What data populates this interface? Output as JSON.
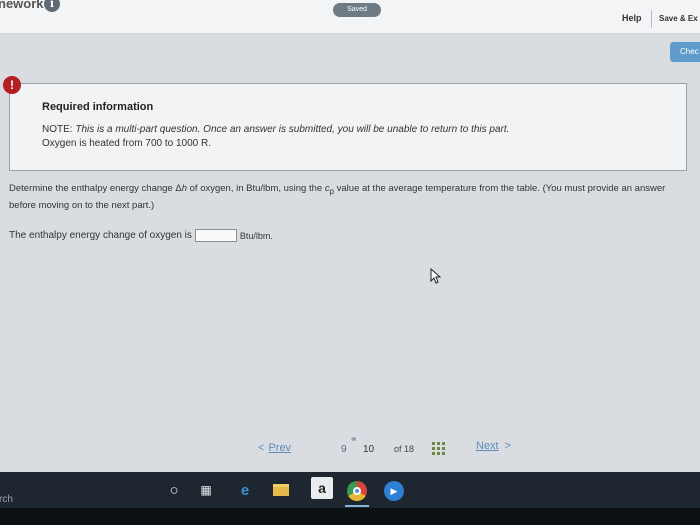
{
  "header": {
    "app_title": "nework",
    "info_icon": "info-icon",
    "saved_label": "Saved",
    "help_label": "Help",
    "save_exit_label": "Save & Ex"
  },
  "check_button": {
    "label": "Chec"
  },
  "required_info": {
    "alert_icon": "!",
    "title": "Required information",
    "note_label": "NOTE:",
    "note_text": "This is a multi-part question. Once an answer is submitted, you will be unable to return to this part.",
    "given": "Oxygen is heated from 700 to 1000 R."
  },
  "question": {
    "text_before": "Determine the enthalpy energy change Δ",
    "h_symbol": "h",
    "text_middle": " of oxygen, in Btu/lbm, using the ",
    "cp_symbol": "c",
    "cp_subscript": "p",
    "text_after": " value at the average temperature from the table. (You must provide an answer before moving on to the next part.)"
  },
  "answer": {
    "prompt": "The enthalpy energy change of oxygen is",
    "value": "",
    "unit": "Btu/lbm."
  },
  "pager": {
    "prev_label": "Prev",
    "current_page": "9",
    "next_page": "10",
    "of_label": "of 18",
    "next_label": "Next"
  },
  "taskbar": {
    "search_fragment": "rch",
    "amazon_letter": "a"
  },
  "colors": {
    "accent_blue": "#5f9ccb",
    "alert_red": "#b31f24",
    "link_blue": "#5c8dbb",
    "taskbar": "#1e2730"
  }
}
